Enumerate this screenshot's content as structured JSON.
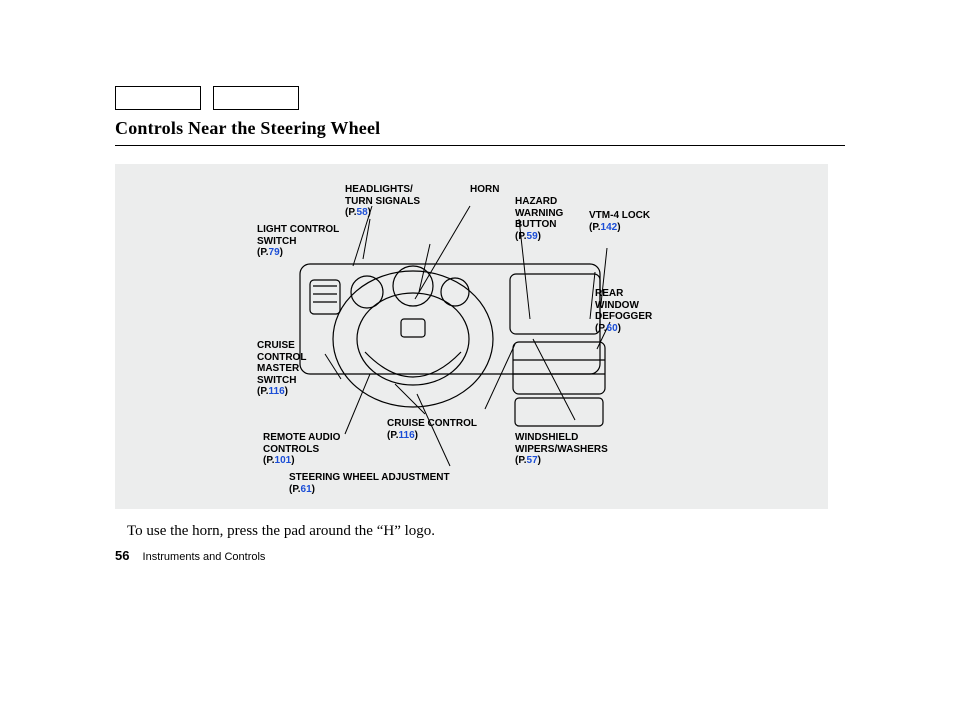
{
  "page": {
    "title": "Controls Near the Steering Wheel",
    "caption": "To use the horn, press the pad around the “H” logo.",
    "number": "56",
    "section": "Instruments and Controls"
  },
  "labels": {
    "headlights": {
      "text": "HEADLIGHTS/\nTURN SIGNALS",
      "pg": "58"
    },
    "horn": {
      "text": "HORN"
    },
    "hazard": {
      "text": "HAZARD\nWARNING\nBUTTON",
      "pg": "59"
    },
    "vtm4": {
      "text": "VTM-4 LOCK",
      "pg": "142"
    },
    "light_ctrl": {
      "text": "LIGHT CONTROL\nSWITCH",
      "pg": "79"
    },
    "rear_def": {
      "text": "REAR\nWINDOW\nDEFOGGER",
      "pg": "60"
    },
    "cruise_sw": {
      "text": "CRUISE\nCONTROL\nMASTER\nSWITCH",
      "pg": "116"
    },
    "remote_aud": {
      "text": "REMOTE AUDIO\nCONTROLS",
      "pg": "101"
    },
    "cruise": {
      "text": "CRUISE CONTROL",
      "pg": "116"
    },
    "windshield": {
      "text": "WINDSHIELD\nWIPERS/WASHERS",
      "pg": "57"
    },
    "steer_adj": {
      "text": "STEERING WHEEL ADJUSTMENT",
      "pg": "61"
    }
  }
}
